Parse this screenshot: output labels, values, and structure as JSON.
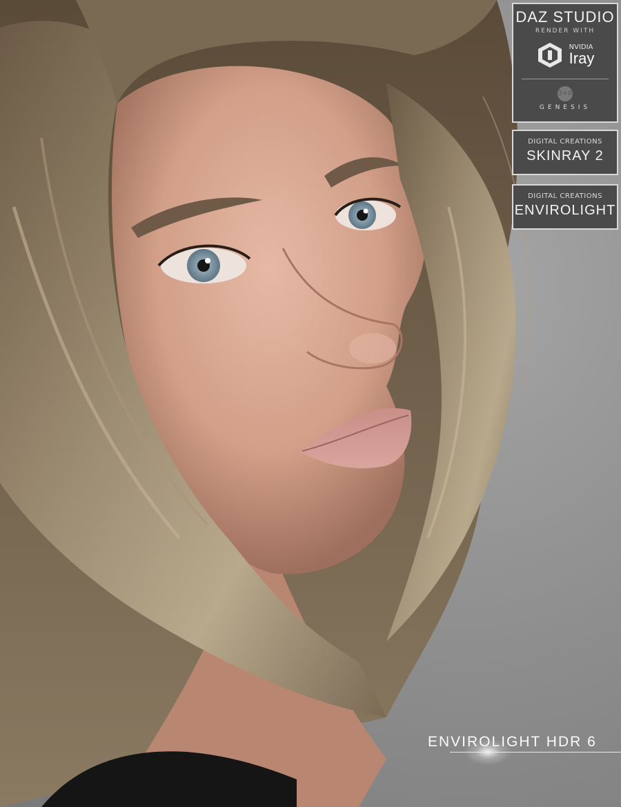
{
  "colors": {
    "background": "#8c8c8c",
    "badge_bg": "#4a4a4a",
    "badge_border": "#d9d9d9",
    "hair": "#8a7a63",
    "skin": "#d9a893"
  },
  "daz_badge": {
    "title": "DAZ STUDIO",
    "subtitle": "RENDER WITH",
    "nvidia_brand": "NVIDIA",
    "nvidia_product": "Iray",
    "genesis_number": "3+8",
    "genesis_label": "GENESIS"
  },
  "skinray_badge": {
    "top": "DIGITAL CREATIONS",
    "main": "SKINRAY 2"
  },
  "envirolight_badge": {
    "top": "DIGITAL CREATIONS",
    "main": "ENVIROLIGHT"
  },
  "product_title": "ENVIROLIGHT HDR 6",
  "icons": {
    "nvidia": "nvidia-logo-icon",
    "genesis": "genesis-logo-icon"
  }
}
